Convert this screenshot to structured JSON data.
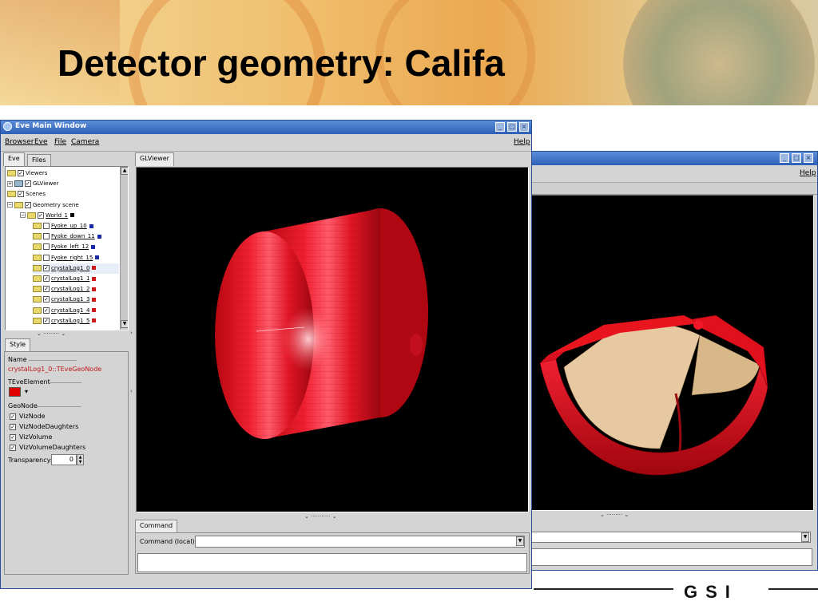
{
  "slide": {
    "title": "Detector geometry: Califa",
    "footer_logo": "GSI"
  },
  "main_window": {
    "title": "Eve Main Window",
    "menus": [
      "Browser",
      "Eve",
      "File",
      "Camera"
    ],
    "help": "Help",
    "left_tabs": [
      "Eve",
      "Files"
    ],
    "viewer_tab": "GLViewer",
    "tree": [
      {
        "label": "Viewers",
        "depth": 0,
        "folder": true,
        "expand": "",
        "checked": true,
        "underline": false,
        "color": ""
      },
      {
        "label": "GLViewer",
        "depth": 0,
        "folder": false,
        "expand": "+",
        "checked": true,
        "underline": false,
        "color": ""
      },
      {
        "label": "Scenes",
        "depth": 0,
        "folder": true,
        "expand": "",
        "checked": true,
        "underline": false,
        "color": ""
      },
      {
        "label": "Geometry scene",
        "depth": 0,
        "folder": true,
        "expand": "-",
        "checked": true,
        "underline": false,
        "color": ""
      },
      {
        "label": "World_1",
        "depth": 1,
        "folder": true,
        "expand": "-",
        "checked": true,
        "underline": true,
        "color": "#000000"
      },
      {
        "label": "Fyoke_up_10",
        "depth": 2,
        "folder": true,
        "expand": "",
        "checked": false,
        "underline": true,
        "color": "#1a2aa8"
      },
      {
        "label": "Fyoke_down_11",
        "depth": 2,
        "folder": true,
        "expand": "",
        "checked": false,
        "underline": true,
        "color": "#1a2aa8"
      },
      {
        "label": "Fyoke_left_12",
        "depth": 2,
        "folder": true,
        "expand": "",
        "checked": false,
        "underline": true,
        "color": "#1a2aa8"
      },
      {
        "label": "Fyoke_right_15",
        "depth": 2,
        "folder": true,
        "expand": "",
        "checked": false,
        "underline": true,
        "color": "#1a2aa8"
      },
      {
        "label": "crystalLog1_0",
        "depth": 2,
        "folder": true,
        "expand": "",
        "checked": true,
        "underline": true,
        "color": "#cc1a1a"
      },
      {
        "label": "crystalLog1_1",
        "depth": 2,
        "folder": true,
        "expand": "",
        "checked": true,
        "underline": true,
        "color": "#cc1a1a"
      },
      {
        "label": "crystalLog1_2",
        "depth": 2,
        "folder": true,
        "expand": "",
        "checked": true,
        "underline": true,
        "color": "#cc1a1a"
      },
      {
        "label": "crystalLog1_3",
        "depth": 2,
        "folder": true,
        "expand": "",
        "checked": true,
        "underline": true,
        "color": "#cc1a1a"
      },
      {
        "label": "crystalLog1_4",
        "depth": 2,
        "folder": true,
        "expand": "",
        "checked": true,
        "underline": true,
        "color": "#cc1a1a"
      },
      {
        "label": "crystalLog1_5",
        "depth": 2,
        "folder": true,
        "expand": "",
        "checked": true,
        "underline": true,
        "color": "#cc1a1a"
      }
    ],
    "editor": {
      "tab": "Style",
      "name_label": "Name",
      "name_value": "crystalLog1_0::TEveGeoNode",
      "element_label": "TEveElement",
      "element_color": "#e00000",
      "geonode_label": "GeoNode",
      "checks": [
        {
          "label": "VizNode",
          "checked": true
        },
        {
          "label": "VizNodeDaughters",
          "checked": true
        },
        {
          "label": "VizVolume",
          "checked": true
        },
        {
          "label": "VizVolumeDaughters",
          "checked": true
        }
      ],
      "transparency_label": "Transparency:",
      "transparency_value": "0"
    },
    "command": {
      "tab": "Command",
      "label": "Command (local):",
      "value": "",
      "output": ""
    }
  },
  "back_window": {
    "help": "Help"
  },
  "colors": {
    "detector_red": "#e0141e",
    "inner_beige": "#e6c9a0",
    "window_blue": "#2d5fb8"
  }
}
